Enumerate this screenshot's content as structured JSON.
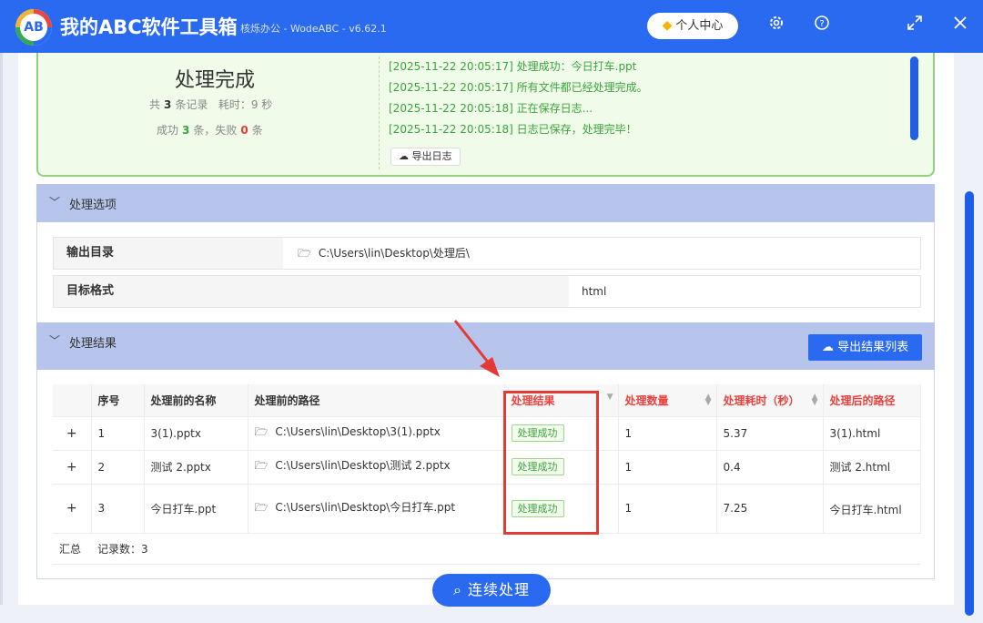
{
  "app": {
    "title": "我的ABC软件工具箱",
    "subtitle": "核烁办公 - WodeABC - v6.62.1",
    "logo_text": "AB",
    "user_center": "个人中心",
    "colors": {
      "primary": "#2a6af0",
      "success": "#3aa53a",
      "danger": "#e53935",
      "section": "#b7c5ec"
    }
  },
  "toolbar_icons": [
    "gear-icon",
    "help-icon",
    "expand-icon",
    "close-icon"
  ],
  "summary": {
    "title": "处理完成",
    "total_prefix": "共",
    "total": "3",
    "total_suffix": "条记录",
    "time_label": "耗时：",
    "time_value": "9 秒",
    "success_prefix": "成功",
    "success": "3",
    "success_suffix": "条，失败",
    "fail": "0",
    "fail_suffix": "条",
    "log": [
      "[2025-11-22 20:05:17] 处理成功：今日打车.ppt",
      "[2025-11-22 20:05:17] 所有文件都已经处理完成。",
      "[2025-11-22 20:05:18] 正在保存日志...",
      "[2025-11-22 20:05:18] 日志已保存，处理完毕！"
    ],
    "export_log": "导出日志"
  },
  "options": {
    "title": "处理选项",
    "output_dir_label": "输出目录",
    "output_dir_value": "C:\\Users\\lin\\Desktop\\处理后\\",
    "format_label": "目标格式",
    "format_value": "html"
  },
  "results": {
    "title": "处理结果",
    "export_button": "导出结果列表",
    "columns": [
      "序号",
      "处理前的名称",
      "处理前的路径",
      "处理结果",
      "处理数量",
      "处理耗时（秒）",
      "处理后的路径"
    ],
    "rows": [
      {
        "expand": "+",
        "index": "1",
        "name": "3(1).pptx",
        "path": "C:\\Users\\lin\\Desktop\\3(1).pptx",
        "result": "处理成功",
        "count": "1",
        "time": "5.37",
        "out": "3(1).html"
      },
      {
        "expand": "+",
        "index": "2",
        "name": "测试 2.pptx",
        "path": "C:\\Users\\lin\\Desktop\\测试 2.pptx",
        "result": "处理成功",
        "count": "1",
        "time": "0.4",
        "out": "测试 2.html"
      },
      {
        "expand": "+",
        "index": "3",
        "name": "今日打车.ppt",
        "path": "C:\\Users\\lin\\Desktop\\今日打车.ppt",
        "result": "处理成功",
        "count": "1",
        "time": "7.25",
        "out": "今日打车.html"
      }
    ],
    "footer_label": "汇总",
    "footer_count": "记录数：3"
  },
  "continue_button": "连续处理"
}
